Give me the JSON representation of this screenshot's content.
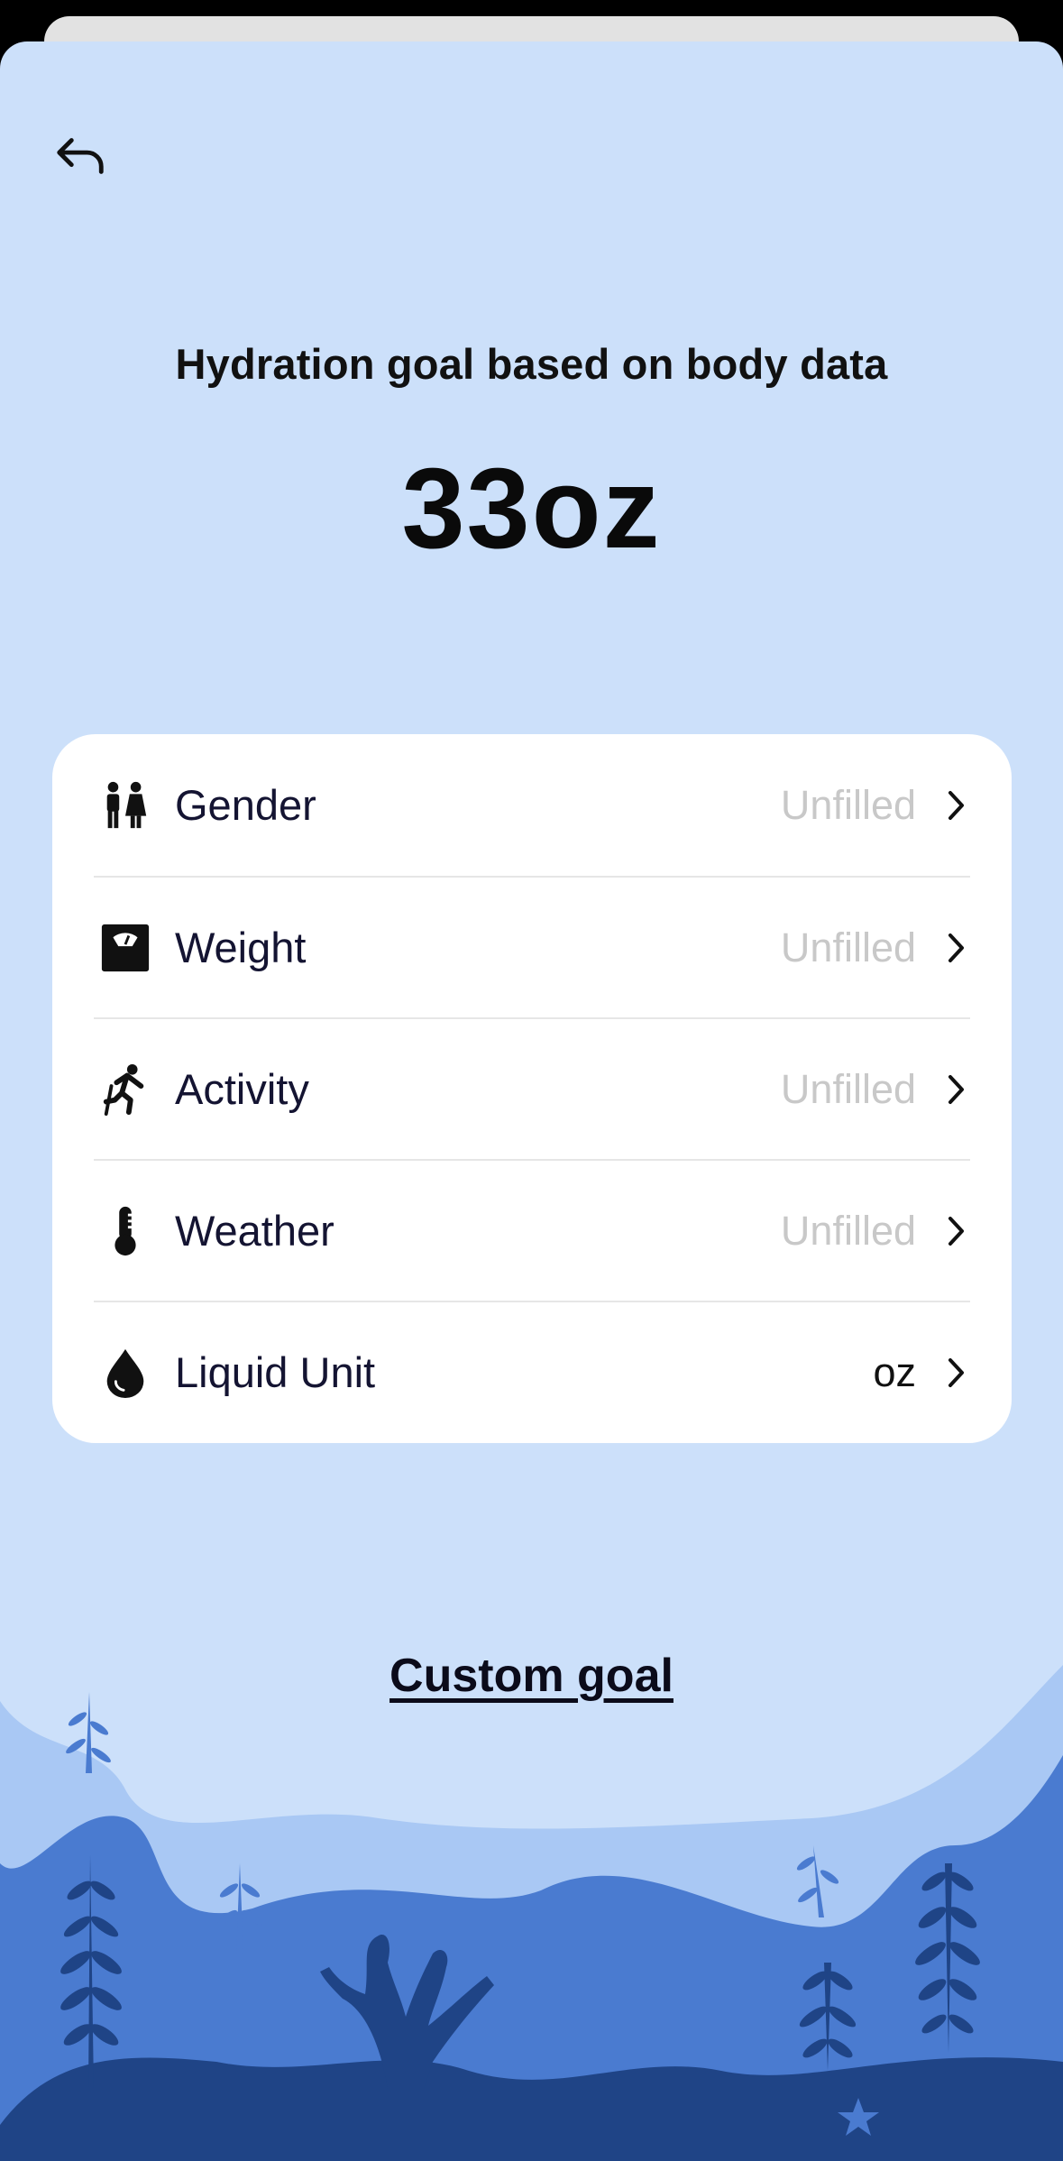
{
  "header": {
    "back_icon": "back-arrow-icon"
  },
  "goal": {
    "heading": "Hydration goal based on body data",
    "value": "33oz"
  },
  "settings": [
    {
      "id": "gender",
      "icon": "gender-icon",
      "label": "Gender",
      "value": "Unfilled"
    },
    {
      "id": "weight",
      "icon": "scale-icon",
      "label": "Weight",
      "value": "Unfilled"
    },
    {
      "id": "activity",
      "icon": "running-icon",
      "label": "Activity",
      "value": "Unfilled"
    },
    {
      "id": "weather",
      "icon": "thermometer-icon",
      "label": "Weather",
      "value": "Unfilled"
    },
    {
      "id": "liquid-unit",
      "icon": "water-drop-icon",
      "label": "Liquid Unit",
      "value": "oz"
    }
  ],
  "footer": {
    "custom_goal_label": "Custom goal"
  },
  "colors": {
    "background": "#cce0fa",
    "card": "#ffffff",
    "wave_light": "#a9c8f4",
    "wave_mid": "#4a7bd0",
    "wave_dark": "#1f4486",
    "unfilled_text": "#c8c8c8"
  }
}
